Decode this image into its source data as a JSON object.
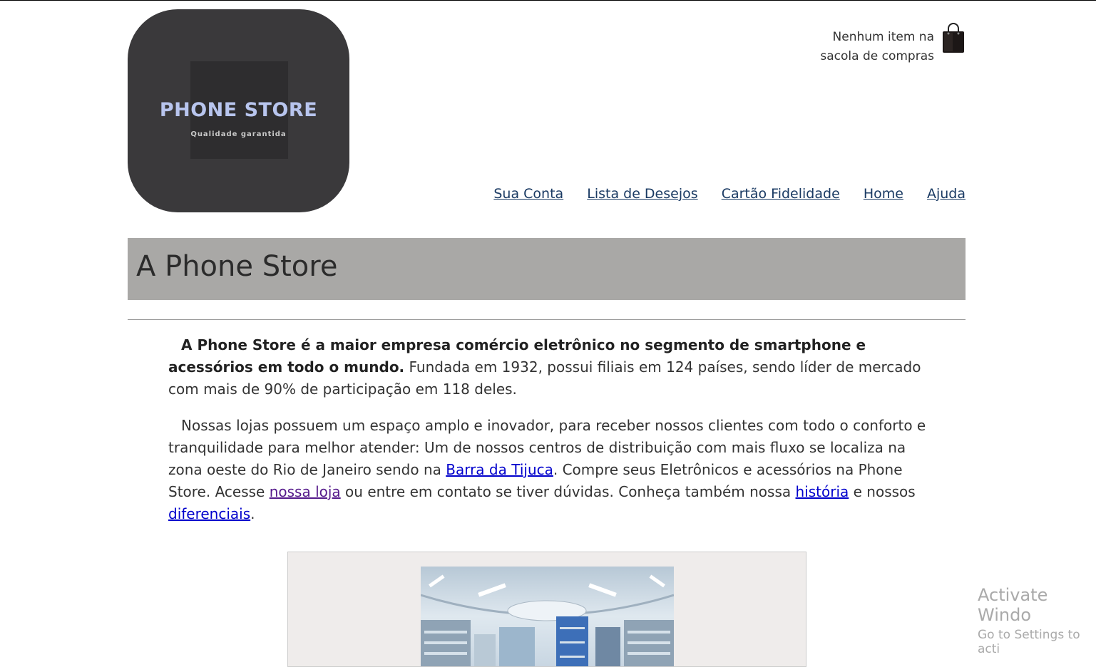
{
  "header": {
    "logo_name": "PHONE STORE",
    "logo_tagline": "Qualidade garantida",
    "cart_text_line1": "Nenhum item na",
    "cart_text_line2": "sacola de compras"
  },
  "nav": [
    "Sua Conta",
    "Lista de Desejos",
    "Cartão Fidelidade",
    "Home",
    "Ajuda"
  ],
  "page_title": "A Phone Store",
  "paragraph1": {
    "bold": "A Phone Store é a maior empresa comércio eletrônico no segmento de smartphone e acessórios em todo o mundo.",
    "rest": " Fundada em 1932, possui filiais em 124 países, sendo líder de mercado com mais de 90% de participação em 118 deles."
  },
  "paragraph2": {
    "t1": "Nossas lojas possuem um espaço amplo e inovador, para receber nossos clientes com todo o conforto e tranquilidade para melhor atender: Um de nossos centros de distribuição com mais fluxo se localiza na zona oeste do Rio de Janeiro sendo na ",
    "link1": "Barra da Tijuca",
    "t2": ". Compre seus Eletrônicos e acessórios na Phone Store. Acesse ",
    "link2": "nossa loja",
    "t3": " ou entre em contato se tiver dúvidas. Conheça também nossa ",
    "link3": "história",
    "t4": " e nossos ",
    "link4": "diferenciais",
    "t5": "."
  },
  "watermark": {
    "line1": "Activate Windo",
    "line2": "Go to Settings to acti"
  }
}
